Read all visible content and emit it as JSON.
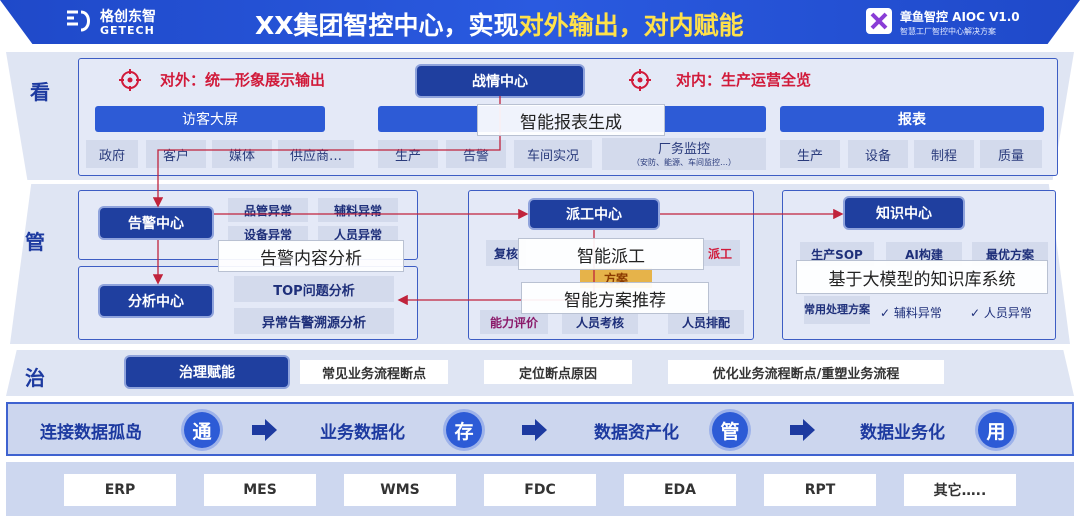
{
  "header": {
    "logo_cn": "格创东智",
    "logo_en": "GETECH",
    "title_part1": "XX集团智控中心，实现",
    "title_part2": "对外输出，对内赋能",
    "product_name": "章鱼智控 AIOC V1.0",
    "product_sub": "智慧工厂智控中心解决方案"
  },
  "rows": {
    "look": "看",
    "manage": "管",
    "govern": "治"
  },
  "look": {
    "external": "对外：统一形象展示输出",
    "internal": "对内：生产运营全览",
    "war_room": "战情中心",
    "visitor_screen": "访客大屏",
    "report_title": "报表",
    "visitor_items": [
      "政府",
      "客户",
      "媒体",
      "供应商…"
    ],
    "mid_items": [
      "生产",
      "告警",
      "车间实况"
    ],
    "factory_monitor": "厂务监控",
    "factory_monitor_sub": "（安防、能源、车间监控…）",
    "report_items": [
      "生产",
      "设备",
      "制程",
      "质量"
    ]
  },
  "manage": {
    "alarm_center": "告警中心",
    "alarm_items": [
      "品管异常",
      "辅料异常",
      "设备异常",
      "人员异常"
    ],
    "analysis_center": "分析中心",
    "analysis_items": [
      "TOP问题分析",
      "异常告警溯源分析"
    ],
    "dispatch_center": "派工中心",
    "dispatch_left": "复核",
    "dispatch_right": "派工",
    "dispatch_mid": "方案",
    "dispatch_bottom": [
      "能力评价",
      "人员考核",
      "人员排配"
    ],
    "knowledge_center": "知识中心",
    "knowledge_items": [
      "生产SOP",
      "AI构建",
      "最优方案"
    ],
    "knowledge_bottom": "常用处理方案",
    "knowledge_checks": [
      "✓ 辅料异常",
      "✓ 人员异常"
    ]
  },
  "overlays": {
    "report_gen": "智能报表生成",
    "alarm_analysis": "告警内容分析",
    "smart_dispatch": "智能派工",
    "plan_recommend": "智能方案推荐",
    "kb_system": "基于大模型的知识库系统"
  },
  "govern": {
    "empower": "治理赋能",
    "items": [
      "常见业务流程断点",
      "定位断点原因",
      "优化业务流程断点/重塑业务流程"
    ]
  },
  "flow": {
    "steps": [
      "连接数据孤岛",
      "业务数据化",
      "数据资产化",
      "数据业务化"
    ],
    "circles": [
      "通",
      "存",
      "管",
      "用"
    ]
  },
  "systems": [
    "ERP",
    "MES",
    "WMS",
    "FDC",
    "EDA",
    "RPT",
    "其它….."
  ],
  "colors": {
    "primary": "#1f3f9f",
    "accent": "#2d5bd6",
    "highlight": "#ffe14a",
    "alert": "#d11a3a"
  }
}
